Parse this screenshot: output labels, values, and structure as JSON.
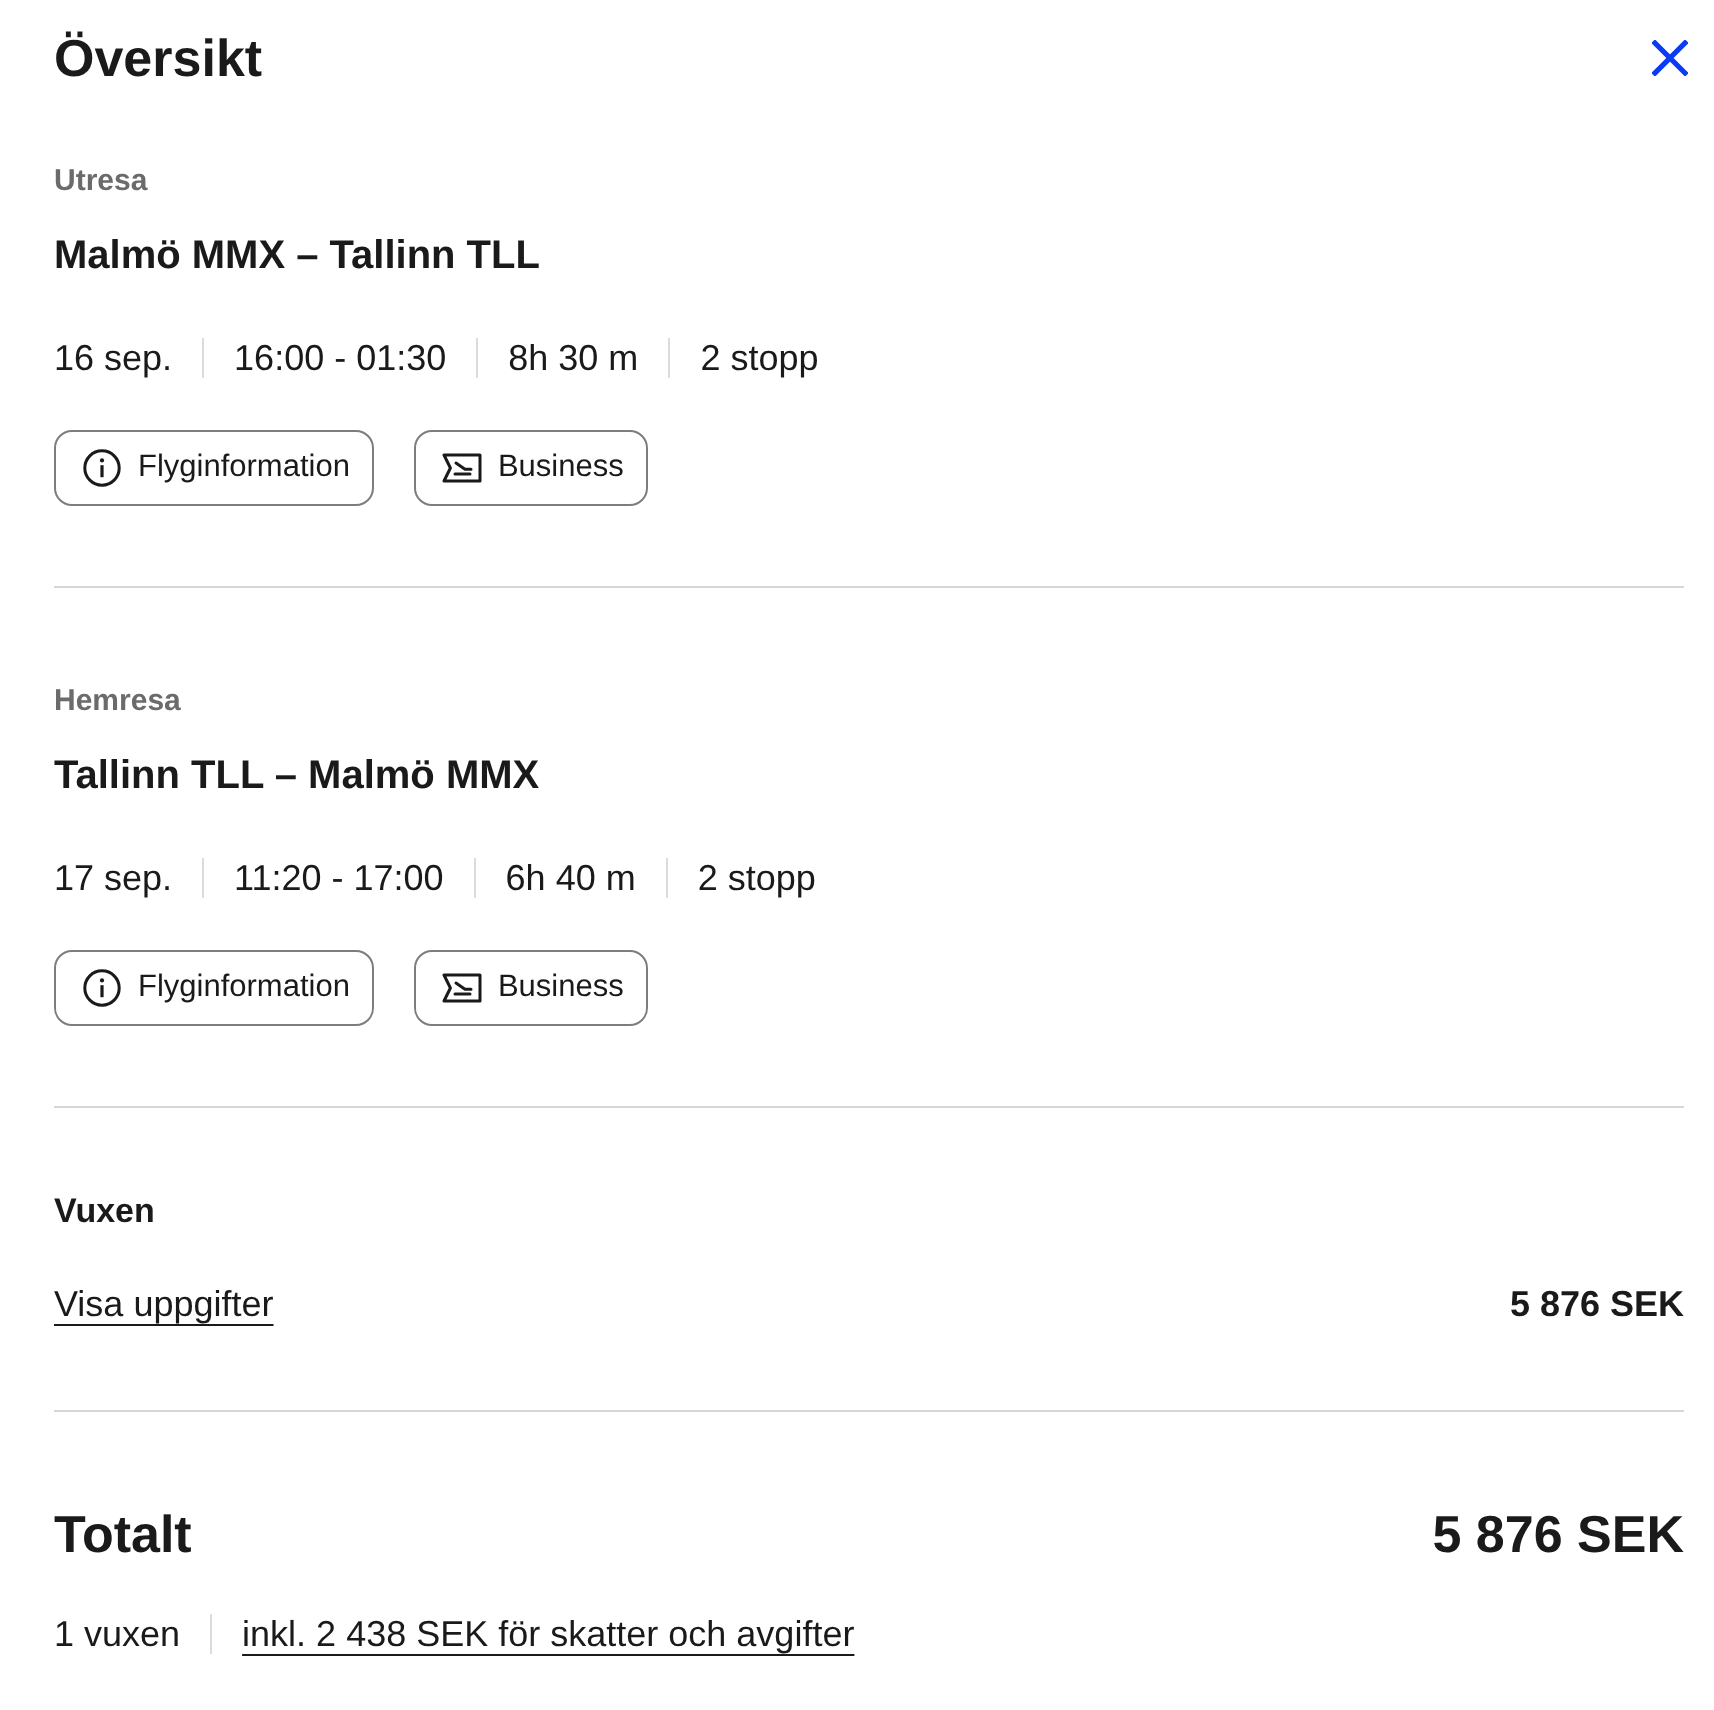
{
  "header": {
    "title": "Översikt"
  },
  "legs": [
    {
      "label": "Utresa",
      "route": "Malmö MMX – Tallinn TLL",
      "date": "16 sep.",
      "time": "16:00 - 01:30",
      "duration": "8h 30 m",
      "stops": "2 stopp",
      "buttons": [
        {
          "kind": "info",
          "label": "Flyginformation"
        },
        {
          "kind": "cabin",
          "label": "Business"
        }
      ]
    },
    {
      "label": "Hemresa",
      "route": "Tallinn TLL – Malmö MMX",
      "date": "17 sep.",
      "time": "11:20 - 17:00",
      "duration": "6h 40 m",
      "stops": "2 stopp",
      "buttons": [
        {
          "kind": "info",
          "label": "Flyginformation"
        },
        {
          "kind": "cabin",
          "label": "Business"
        }
      ]
    }
  ],
  "passengers": [
    {
      "type": "Vuxen",
      "link": "Visa uppgifter",
      "price": "5 876 SEK"
    }
  ],
  "total": {
    "label": "Totalt",
    "price": "5 876 SEK",
    "passengers": "1 vuxen",
    "taxes_link": "inkl. 2 438 SEK för skatter och avgifter"
  }
}
